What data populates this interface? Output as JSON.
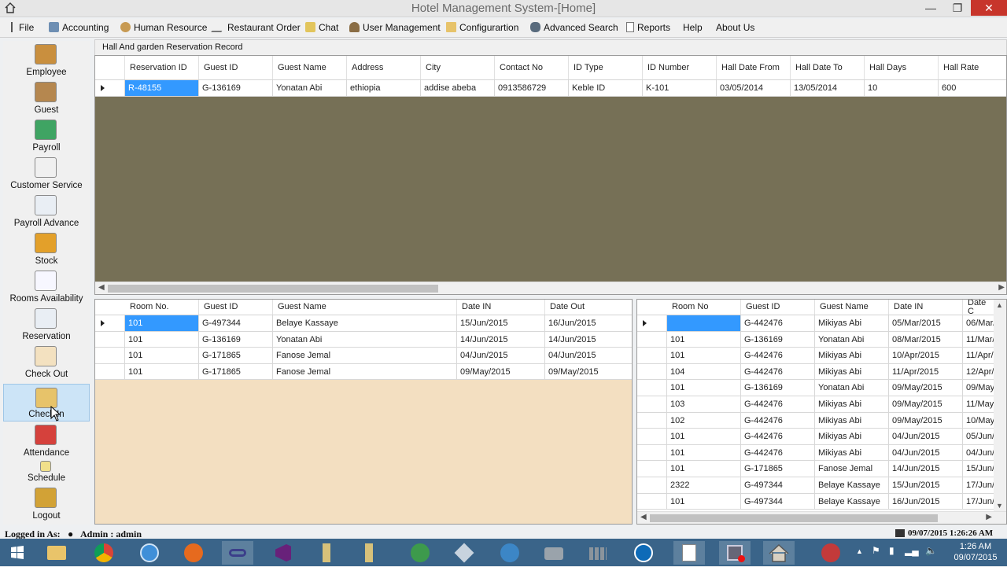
{
  "window": {
    "title": "Hotel Management System-[Home]"
  },
  "menu": [
    {
      "label": "File",
      "icon": "file-icon"
    },
    {
      "label": "Accounting",
      "icon": "accounting-icon"
    },
    {
      "label": "Human Resource",
      "icon": "people-icon"
    },
    {
      "label": "Restaurant Order",
      "icon": "pencil-icon"
    },
    {
      "label": "Chat",
      "icon": "chat-icon"
    },
    {
      "label": "User Management",
      "icon": "user-icon"
    },
    {
      "label": "Configurartion",
      "icon": "folder-icon"
    },
    {
      "label": "Advanced Search",
      "icon": "binoculars-icon"
    },
    {
      "label": "Reports",
      "icon": "report-icon"
    },
    {
      "label": "Help"
    },
    {
      "label": "About Us"
    }
  ],
  "sidebar": [
    {
      "label": "Employee",
      "icon": "employee-icon"
    },
    {
      "label": "Guest",
      "icon": "guest-icon"
    },
    {
      "label": "Payroll",
      "icon": "payroll-icon"
    },
    {
      "label": "Customer Service",
      "icon": "customer-service-icon"
    },
    {
      "label": "Payroll Advance",
      "icon": "chart-icon"
    },
    {
      "label": "Stock",
      "icon": "stock-icon"
    },
    {
      "label": "Rooms Availability",
      "icon": "notebook-icon"
    },
    {
      "label": "Reservation",
      "icon": "reservation-icon"
    },
    {
      "label": "Check Out",
      "icon": "checkout-icon"
    },
    {
      "label": "Check In",
      "icon": "checkin-icon"
    },
    {
      "label": "Attendance",
      "icon": "calendar-clock-icon"
    },
    {
      "label": "Schedule",
      "icon": "schedule-icon"
    },
    {
      "label": "Logout",
      "icon": "lock-icon"
    }
  ],
  "hall_panel": {
    "title": "Hall And garden Reservation Record",
    "columns": [
      "Reservation ID",
      "Guest ID",
      "Guest Name",
      "Address",
      "City",
      "Contact No",
      "ID Type",
      "ID Number",
      "Hall Date From",
      "Hall Date To",
      "Hall Days",
      "Hall Rate"
    ],
    "rows": [
      [
        "R-48155",
        "G-136169",
        "Yonatan Abi",
        "ethiopia",
        "addise abeba",
        "0913586729",
        "Keble  ID",
        "K-101",
        "03/05/2014",
        "13/05/2014",
        "10",
        "600"
      ]
    ]
  },
  "checkin_grid": {
    "columns": [
      "Room No.",
      "Guest ID",
      "Guest Name",
      "Date IN",
      "Date Out"
    ],
    "rows": [
      [
        "101",
        "G-497344",
        "Belaye Kassaye",
        "15/Jun/2015",
        "16/Jun/2015"
      ],
      [
        "101",
        "G-136169",
        "Yonatan Abi",
        "14/Jun/2015",
        "14/Jun/2015"
      ],
      [
        "101",
        "G-171865",
        "Fanose Jemal",
        "04/Jun/2015",
        "04/Jun/2015"
      ],
      [
        "101",
        "G-171865",
        "Fanose Jemal",
        "09/May/2015",
        "09/May/2015"
      ]
    ]
  },
  "history_grid": {
    "columns": [
      "Room No",
      "Guest ID",
      "Guest Name",
      "Date IN",
      "Date C"
    ],
    "rows": [
      [
        "",
        "G-442476",
        "Mikiyas Abi",
        "05/Mar/2015",
        "06/Mar/"
      ],
      [
        "101",
        "G-136169",
        "Yonatan Abi",
        "08/Mar/2015",
        "11/Mar/"
      ],
      [
        "101",
        "G-442476",
        "Mikiyas Abi",
        "10/Apr/2015",
        "11/Apr/"
      ],
      [
        "104",
        "G-442476",
        "Mikiyas Abi",
        "11/Apr/2015",
        "12/Apr/"
      ],
      [
        "101",
        "G-136169",
        "Yonatan Abi",
        "09/May/2015",
        "09/May"
      ],
      [
        "103",
        "G-442476",
        "Mikiyas Abi",
        "09/May/2015",
        "11/May/"
      ],
      [
        "102",
        "G-442476",
        "Mikiyas Abi",
        "09/May/2015",
        "10/May/"
      ],
      [
        "101",
        "G-442476",
        "Mikiyas Abi",
        "04/Jun/2015",
        "05/Jun/"
      ],
      [
        "101",
        "G-442476",
        "Mikiyas Abi",
        "04/Jun/2015",
        "04/Jun/"
      ],
      [
        "101",
        "G-171865",
        "Fanose Jemal",
        "14/Jun/2015",
        "15/Jun/"
      ],
      [
        "2322",
        "G-497344",
        "Belaye Kassaye",
        "15/Jun/2015",
        "17/Jun/"
      ],
      [
        "101",
        "G-497344",
        "Belaye Kassaye",
        "16/Jun/2015",
        "17/Jun/"
      ]
    ]
  },
  "status": {
    "logged_in": "Logged in As:",
    "user": "Admin  :  admin",
    "datetime": "09/07/2015 1:26:26 AM"
  },
  "taskbar": {
    "time": "1:26 AM",
    "date": "09/07/2015"
  },
  "colors": {
    "hall_bg": "#767056",
    "checkin_bg": "#f3dfc1",
    "selection": "#3399ff",
    "taskbar": "#3a6489",
    "close": "#c7352b"
  }
}
